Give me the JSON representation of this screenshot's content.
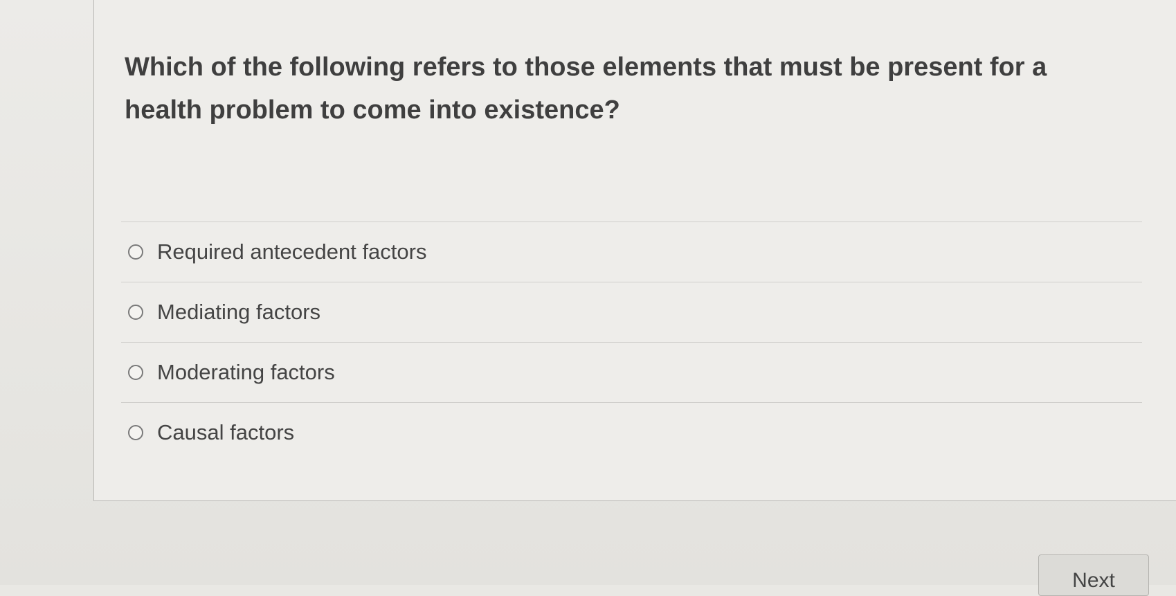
{
  "question": {
    "text": "Which of the following refers to those elements that must be present for a health problem to come into existence?"
  },
  "answers": [
    {
      "label": "Required antecedent factors",
      "selected": false
    },
    {
      "label": "Mediating factors",
      "selected": false
    },
    {
      "label": "Moderating factors",
      "selected": false
    },
    {
      "label": "Causal factors",
      "selected": false
    }
  ],
  "navigation": {
    "next_label": "Next"
  }
}
